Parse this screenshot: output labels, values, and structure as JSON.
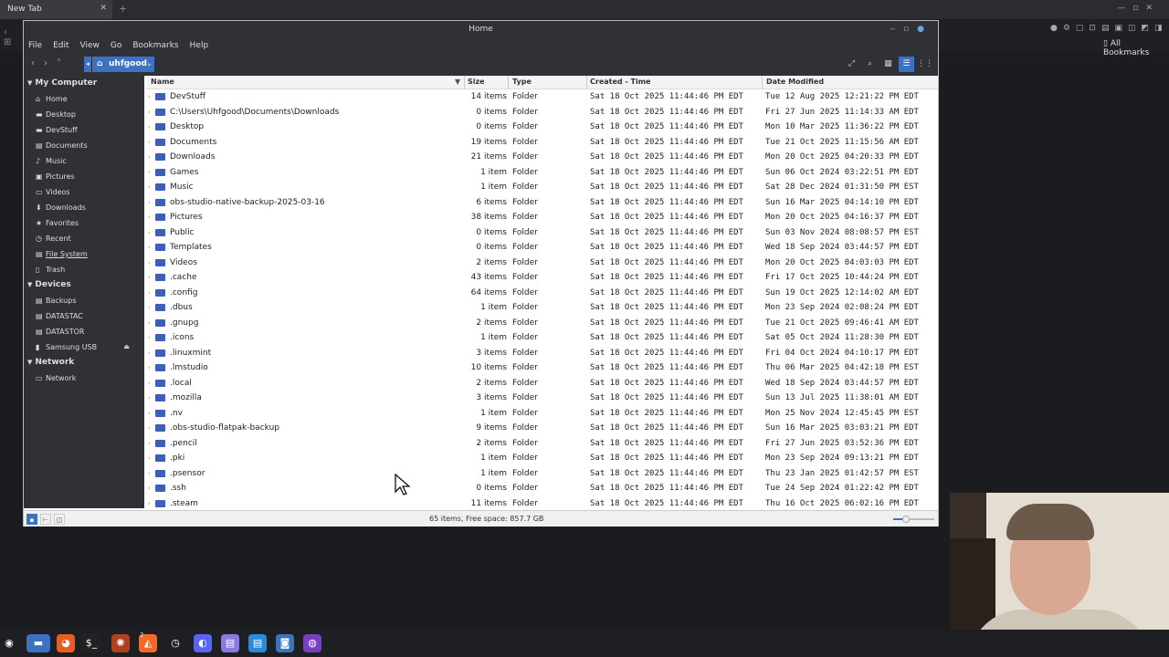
{
  "browser": {
    "tab_title": "New Tab",
    "all_bookmarks": "All Bookmarks"
  },
  "window": {
    "title": "Home",
    "menu": [
      "File",
      "Edit",
      "View",
      "Go",
      "Bookmarks",
      "Help"
    ],
    "breadcrumb": "uhfgood"
  },
  "sidebar": {
    "sections": [
      {
        "title": "My Computer",
        "items": [
          {
            "label": "Home",
            "icon": "home-icon"
          },
          {
            "label": "Desktop",
            "icon": "folder-icon"
          },
          {
            "label": "DevStuff",
            "icon": "folder-icon"
          },
          {
            "label": "Documents",
            "icon": "document-icon"
          },
          {
            "label": "Music",
            "icon": "music-icon"
          },
          {
            "label": "Pictures",
            "icon": "picture-icon"
          },
          {
            "label": "Videos",
            "icon": "video-icon"
          },
          {
            "label": "Downloads",
            "icon": "download-icon"
          },
          {
            "label": "Favorites",
            "icon": "star-icon"
          },
          {
            "label": "Recent",
            "icon": "clock-icon"
          },
          {
            "label": "File System",
            "icon": "drive-icon"
          },
          {
            "label": "Trash",
            "icon": "trash-icon"
          }
        ]
      },
      {
        "title": "Devices",
        "items": [
          {
            "label": "Backups",
            "icon": "drive-icon"
          },
          {
            "label": "DATASTAC",
            "icon": "drive-icon"
          },
          {
            "label": "DATASTOR",
            "icon": "drive-icon"
          },
          {
            "label": "Samsung USB",
            "icon": "usb-icon"
          }
        ]
      },
      {
        "title": "Network",
        "items": [
          {
            "label": "Network",
            "icon": "network-icon"
          }
        ]
      }
    ]
  },
  "columns": {
    "name": "Name",
    "size": "Size",
    "type": "Type",
    "created": "Created - Time",
    "modified": "Date Modified"
  },
  "files": [
    {
      "name": "DevStuff",
      "size": "14 items",
      "type": "Folder",
      "created": "Sat 18 Oct 2025 11:44:46 PM EDT",
      "modified": "Tue 12 Aug 2025 12:21:22 PM EDT"
    },
    {
      "name": "C:\\Users\\Uhfgood\\Documents\\Downloads",
      "size": "0 items",
      "type": "Folder",
      "created": "Sat 18 Oct 2025 11:44:46 PM EDT",
      "modified": "Fri 27 Jun 2025 11:14:33 AM EDT"
    },
    {
      "name": "Desktop",
      "size": "0 items",
      "type": "Folder",
      "created": "Sat 18 Oct 2025 11:44:46 PM EDT",
      "modified": "Mon 10 Mar 2025 11:36:22 PM EDT"
    },
    {
      "name": "Documents",
      "size": "19 items",
      "type": "Folder",
      "created": "Sat 18 Oct 2025 11:44:46 PM EDT",
      "modified": "Tue 21 Oct 2025 11:15:56 AM EDT"
    },
    {
      "name": "Downloads",
      "size": "21 items",
      "type": "Folder",
      "created": "Sat 18 Oct 2025 11:44:46 PM EDT",
      "modified": "Mon 20 Oct 2025 04:20:33 PM EDT"
    },
    {
      "name": "Games",
      "size": "1 item",
      "type": "Folder",
      "created": "Sat 18 Oct 2025 11:44:46 PM EDT",
      "modified": "Sun 06 Oct 2024 03:22:51 PM EDT"
    },
    {
      "name": "Music",
      "size": "1 item",
      "type": "Folder",
      "created": "Sat 18 Oct 2025 11:44:46 PM EDT",
      "modified": "Sat 28 Dec 2024 01:31:50 PM EST"
    },
    {
      "name": "obs-studio-native-backup-2025-03-16",
      "size": "6 items",
      "type": "Folder",
      "created": "Sat 18 Oct 2025 11:44:46 PM EDT",
      "modified": "Sun 16 Mar 2025 04:14:10 PM EDT"
    },
    {
      "name": "Pictures",
      "size": "38 items",
      "type": "Folder",
      "created": "Sat 18 Oct 2025 11:44:46 PM EDT",
      "modified": "Mon 20 Oct 2025 04:16:37 PM EDT"
    },
    {
      "name": "Public",
      "size": "0 items",
      "type": "Folder",
      "created": "Sat 18 Oct 2025 11:44:46 PM EDT",
      "modified": "Sun 03 Nov 2024 08:08:57 PM EST"
    },
    {
      "name": "Templates",
      "size": "0 items",
      "type": "Folder",
      "created": "Sat 18 Oct 2025 11:44:46 PM EDT",
      "modified": "Wed 18 Sep 2024 03:44:57 PM EDT"
    },
    {
      "name": "Videos",
      "size": "2 items",
      "type": "Folder",
      "created": "Sat 18 Oct 2025 11:44:46 PM EDT",
      "modified": "Mon 20 Oct 2025 04:03:03 PM EDT"
    },
    {
      "name": ".cache",
      "size": "43 items",
      "type": "Folder",
      "created": "Sat 18 Oct 2025 11:44:46 PM EDT",
      "modified": "Fri 17 Oct 2025 10:44:24 PM EDT"
    },
    {
      "name": ".config",
      "size": "64 items",
      "type": "Folder",
      "created": "Sat 18 Oct 2025 11:44:46 PM EDT",
      "modified": "Sun 19 Oct 2025 12:14:02 AM EDT"
    },
    {
      "name": ".dbus",
      "size": "1 item",
      "type": "Folder",
      "created": "Sat 18 Oct 2025 11:44:46 PM EDT",
      "modified": "Mon 23 Sep 2024 02:08:24 PM EDT"
    },
    {
      "name": ".gnupg",
      "size": "2 items",
      "type": "Folder",
      "created": "Sat 18 Oct 2025 11:44:46 PM EDT",
      "modified": "Tue 21 Oct 2025 09:46:41 AM EDT"
    },
    {
      "name": ".icons",
      "size": "1 item",
      "type": "Folder",
      "created": "Sat 18 Oct 2025 11:44:46 PM EDT",
      "modified": "Sat 05 Oct 2024 11:28:30 PM EDT"
    },
    {
      "name": ".linuxmint",
      "size": "3 items",
      "type": "Folder",
      "created": "Sat 18 Oct 2025 11:44:46 PM EDT",
      "modified": "Fri 04 Oct 2024 04:10:17 PM EDT"
    },
    {
      "name": ".lmstudio",
      "size": "10 items",
      "type": "Folder",
      "created": "Sat 18 Oct 2025 11:44:46 PM EDT",
      "modified": "Thu 06 Mar 2025 04:42:18 PM EST"
    },
    {
      "name": ".local",
      "size": "2 items",
      "type": "Folder",
      "created": "Sat 18 Oct 2025 11:44:46 PM EDT",
      "modified": "Wed 18 Sep 2024 03:44:57 PM EDT"
    },
    {
      "name": ".mozilla",
      "size": "3 items",
      "type": "Folder",
      "created": "Sat 18 Oct 2025 11:44:46 PM EDT",
      "modified": "Sun 13 Jul 2025 11:38:01 AM EDT"
    },
    {
      "name": ".nv",
      "size": "1 item",
      "type": "Folder",
      "created": "Sat 18 Oct 2025 11:44:46 PM EDT",
      "modified": "Mon 25 Nov 2024 12:45:45 PM EST"
    },
    {
      "name": ".obs-studio-flatpak-backup",
      "size": "9 items",
      "type": "Folder",
      "created": "Sat 18 Oct 2025 11:44:46 PM EDT",
      "modified": "Sun 16 Mar 2025 03:03:21 PM EDT"
    },
    {
      "name": ".pencil",
      "size": "2 items",
      "type": "Folder",
      "created": "Sat 18 Oct 2025 11:44:46 PM EDT",
      "modified": "Fri 27 Jun 2025 03:52:36 PM EDT"
    },
    {
      "name": ".pki",
      "size": "1 item",
      "type": "Folder",
      "created": "Sat 18 Oct 2025 11:44:46 PM EDT",
      "modified": "Mon 23 Sep 2024 09:13:21 PM EDT"
    },
    {
      "name": ".psensor",
      "size": "1 item",
      "type": "Folder",
      "created": "Sat 18 Oct 2025 11:44:46 PM EDT",
      "modified": "Thu 23 Jan 2025 01:42:57 PM EST"
    },
    {
      "name": ".ssh",
      "size": "0 items",
      "type": "Folder",
      "created": "Sat 18 Oct 2025 11:44:46 PM EDT",
      "modified": "Tue 24 Sep 2024 01:22:42 PM EDT"
    },
    {
      "name": ".steam",
      "size": "11 items",
      "type": "Folder",
      "created": "Sat 18 Oct 2025 11:44:46 PM EDT",
      "modified": "Thu 16 Oct 2025 06:02:16 PM EDT"
    }
  ],
  "status": "65 items, Free space: 857.7 GB",
  "zoom_level": 0.3,
  "colors": {
    "accent": "#3d72c2",
    "folder": "#3d5fb8",
    "chrome": "#2f3136"
  },
  "taskbar": {
    "icons": [
      "mint-menu-icon",
      "files-icon",
      "firefox-icon",
      "terminal-icon",
      "app-icon",
      "brave-icon",
      "clock-app-icon",
      "discord-icon",
      "notes-icon",
      "text-editor-icon",
      "screenshot-icon",
      "github-icon"
    ],
    "badge": "2"
  }
}
